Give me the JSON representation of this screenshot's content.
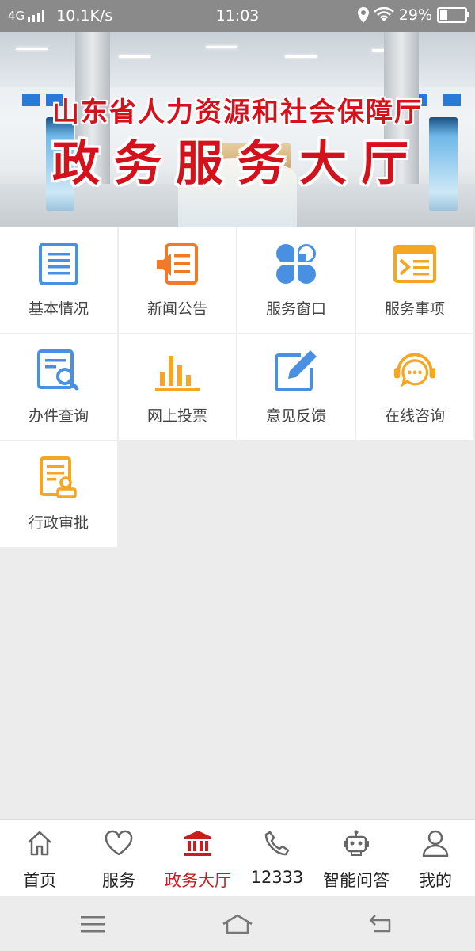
{
  "status_bar": {
    "network": "4G",
    "speed": "10.1K/s",
    "time": "11:03",
    "battery": "29%",
    "battery_level": 0.29
  },
  "banner": {
    "line1": "山东省人力资源和社会保障厅",
    "line2": "政务服务大厅",
    "title_color": "#d3121b"
  },
  "grid": [
    {
      "label": "基本情况",
      "icon": "document-list-icon",
      "color": "#4a90e2"
    },
    {
      "label": "新闻公告",
      "icon": "megaphone-icon",
      "color": "#f07a28"
    },
    {
      "label": "服务窗口",
      "icon": "clover-icon",
      "color": "#4a90e2"
    },
    {
      "label": "服务事项",
      "icon": "service-list-icon",
      "color": "#f5a623"
    },
    {
      "label": "办件查询",
      "icon": "document-search-icon",
      "color": "#4a90e2"
    },
    {
      "label": "网上投票",
      "icon": "bar-chart-icon",
      "color": "#f5a623"
    },
    {
      "label": "意见反馈",
      "icon": "edit-icon",
      "color": "#4a90e2"
    },
    {
      "label": "在线咨询",
      "icon": "chat-headset-icon",
      "color": "#f5a623"
    },
    {
      "label": "行政审批",
      "icon": "approval-stamp-icon",
      "color": "#f5a623"
    }
  ],
  "tabs": [
    {
      "label": "首页",
      "icon": "home-icon",
      "active": false
    },
    {
      "label": "服务",
      "icon": "heart-icon",
      "active": false
    },
    {
      "label": "政务大厅",
      "icon": "government-hall-icon",
      "active": true
    },
    {
      "label": "12333",
      "icon": "phone-icon",
      "active": false
    },
    {
      "label": "智能问答",
      "icon": "robot-icon",
      "active": false
    },
    {
      "label": "我的",
      "icon": "user-icon",
      "active": false
    }
  ],
  "active_color": "#c81e1e"
}
